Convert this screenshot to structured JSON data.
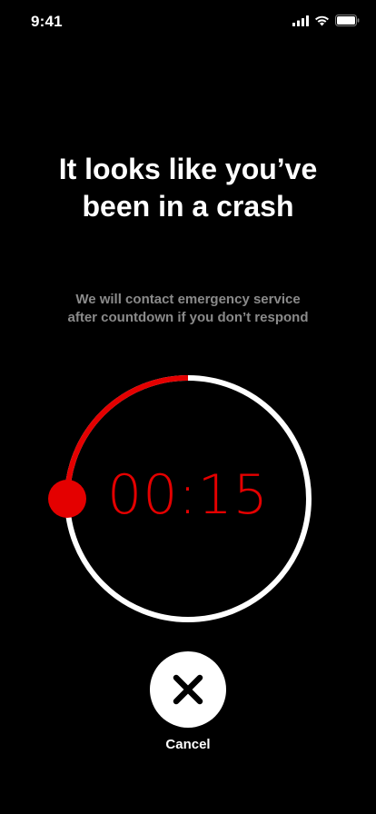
{
  "status_bar": {
    "time": "9:41",
    "icons": [
      "cellular-signal-icon",
      "wifi-icon",
      "battery-icon"
    ]
  },
  "headline": {
    "line1": "It looks like you’ve",
    "line2": "been in a crash"
  },
  "subtext": {
    "line1": "We will contact emergency service",
    "line2": "after countdown if you don’t respond"
  },
  "countdown": {
    "display": "00:15",
    "progress_elapsed_fraction": 0.25
  },
  "cancel": {
    "label": "Cancel",
    "icon": "close-icon"
  },
  "colors": {
    "background": "#000000",
    "accent": "#e40000",
    "ring": "#ffffff",
    "subtext": "#8a8a8a"
  }
}
